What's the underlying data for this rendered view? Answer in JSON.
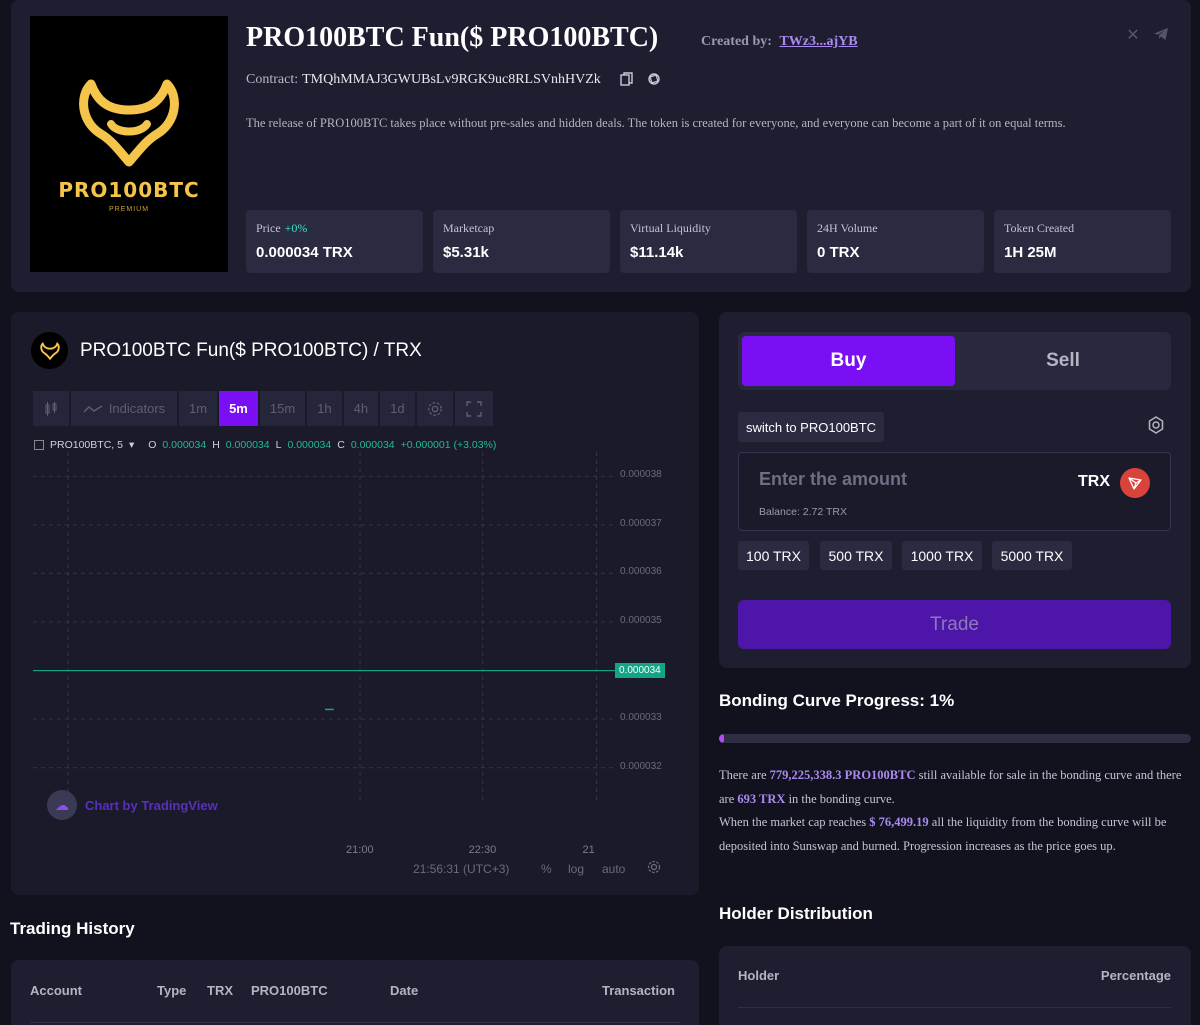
{
  "token": {
    "title": "PRO100BTC Fun($ PRO100BTC)",
    "created_by_label": "Created by:",
    "creator": "TWz3...ajYB",
    "contract_label": "Contract:",
    "contract_address": "TMQhMMAJ3GWUBsLv9RGK9uc8RLSVnhHVZk",
    "description": "The release of PRO100BTC takes place without pre-sales and hidden deals. The token is created for everyone, and everyone can become a part of it on equal terms.",
    "logo_text": "PRO100BTC",
    "logo_sub": "PREMIUM",
    "logo_color": "#f5c44a"
  },
  "stats": [
    {
      "label": "Price",
      "change": "+0%",
      "value": "0.000034 TRX"
    },
    {
      "label": "Marketcap",
      "change": "",
      "value": "$5.31k"
    },
    {
      "label": "Virtual Liquidity",
      "change": "",
      "value": "$11.14k"
    },
    {
      "label": "24H Volume",
      "change": "",
      "value": "0 TRX"
    },
    {
      "label": "Token Created",
      "change": "",
      "value": "1H 25M"
    }
  ],
  "chart": {
    "title": "PRO100BTC Fun($ PRO100BTC) / TRX",
    "toolbar": {
      "indicators": "Indicators",
      "intervals": [
        "1m",
        "5m",
        "15m",
        "1h",
        "4h",
        "1d"
      ],
      "active_interval": "5m"
    },
    "ohlc": {
      "symbol": "PRO100BTC, 5",
      "o_label": "O",
      "o": "0.000034",
      "h_label": "H",
      "h": "0.000034",
      "l_label": "L",
      "l": "0.000034",
      "c_label": "C",
      "c": "0.000034",
      "change": "+0.000001 (+3.03%)"
    },
    "watermark": "Chart by TradingView",
    "time_label": "21:56:31 (UTC+3)",
    "foot_percent": "%",
    "foot_log": "log",
    "foot_auto": "auto",
    "accent_color": "#7a0ff5",
    "up_color": "#12a586"
  },
  "chart_data": {
    "type": "line",
    "title": "",
    "xlabel": "",
    "ylabel": "",
    "x_ticks": [
      "21:00",
      "22:30",
      "21"
    ],
    "y_ticks": [
      3.8e-05,
      3.7e-05,
      3.6e-05,
      3.5e-05,
      3.3e-05,
      3.2e-05
    ],
    "ylim": [
      3.15e-05,
      3.85e-05
    ],
    "current_price": 3.4e-05,
    "current_price_label": "0.000034",
    "series": [
      {
        "values": [
          3.4e-05,
          3.4e-05,
          3.4e-05
        ]
      }
    ],
    "grid": true
  },
  "trade": {
    "buy_label": "Buy",
    "sell_label": "Sell",
    "switch_label": "switch to PRO100BTC",
    "amount_placeholder": "Enter the amount",
    "currency": "TRX",
    "balance": "Balance: 2.72 TRX",
    "quick_amounts": [
      "100 TRX",
      "500 TRX",
      "1000 TRX",
      "5000 TRX"
    ],
    "trade_label": "Trade"
  },
  "bonding": {
    "title": "Bonding Curve Progress: 1%",
    "progress": 0.01,
    "text_1": "There are ",
    "available": "779,225,338.3 PRO100BTC",
    "text_2": " still available for sale in the bonding curve and there are ",
    "trx_amount": "693 TRX",
    "text_3": " in the bonding curve.",
    "text_4": "When the market cap reaches ",
    "market_cap": "$ 76,499.19",
    "text_5": " all the liquidity from the bonding curve will be deposited into Sunswap and burned. Progression increases as the price goes up."
  },
  "holders": {
    "title": "Holder Distribution",
    "col_holder": "Holder",
    "col_percentage": "Percentage"
  },
  "history": {
    "title": "Trading History",
    "columns": [
      "Account",
      "Type",
      "TRX",
      "PRO100BTC",
      "Date",
      "Transaction"
    ]
  }
}
